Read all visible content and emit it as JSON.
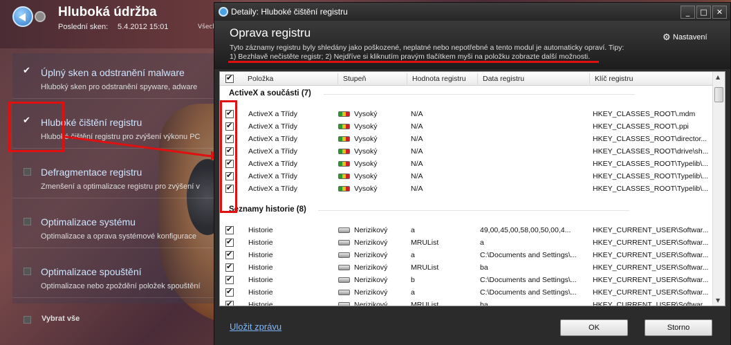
{
  "app": {
    "title": "Hluboká údržba",
    "last_scan_label": "Poslední sken:",
    "last_scan_value": "5.4.2012 15:01",
    "all_link": "Všechny",
    "items": [
      {
        "title": "Úplný sken a odstranění malware",
        "desc": "Hluboký sken pro odstranění spyware, adware",
        "checked": true
      },
      {
        "title": "Hluboké čištění registru",
        "desc": "Hluboké čištění registru pro zvýšení výkonu PC",
        "checked": true
      },
      {
        "title": "Defragmentace registru",
        "desc": "Zmenšení a optimalizace registru pro zvýšení v",
        "checked": false
      },
      {
        "title": "Optimalizace systému",
        "desc": "Optimalizace a oprava systémové konfigurace",
        "checked": false
      },
      {
        "title": "Optimalizace spouštění",
        "desc": "Optimalizace nebo zpoždění položek spouštění",
        "checked": false
      }
    ],
    "select_all": "Vybrat vše"
  },
  "dialog": {
    "title": "Detaily: Hluboké čištění registru",
    "controls": {
      "minimize": "_",
      "maximize": "□",
      "close": "✕"
    },
    "header_title": "Oprava registru",
    "header_desc_line1": "Tyto záznamy registru byly shledány jako poškozené, neplatné nebo nepotřebné a tento modul je automaticky opraví. Tipy:",
    "header_desc_line2": "1)  Bezhlavě nečistěte registr; 2) Nejdříve si kliknutím pravým tlačítkem myši na položku zobrazte další možnosti.",
    "settings_icon": "gear-icon",
    "settings_label": "Nastavení",
    "columns": [
      "Položka",
      "Stupeň",
      "Hodnota registru",
      "Data registru",
      "Klíč registru"
    ],
    "groups": [
      {
        "name": "ActiveX a součásti (7)",
        "rows": [
          {
            "item": "ActiveX a Třídy",
            "severity": "Vysoký",
            "value": "N/A",
            "data": "",
            "key": "HKEY_CLASSES_ROOT\\.mdm"
          },
          {
            "item": "ActiveX a Třídy",
            "severity": "Vysoký",
            "value": "N/A",
            "data": "",
            "key": "HKEY_CLASSES_ROOT\\.ppi"
          },
          {
            "item": "ActiveX a Třídy",
            "severity": "Vysoký",
            "value": "N/A",
            "data": "",
            "key": "HKEY_CLASSES_ROOT\\director..."
          },
          {
            "item": "ActiveX a Třídy",
            "severity": "Vysoký",
            "value": "N/A",
            "data": "",
            "key": "HKEY_CLASSES_ROOT\\drive\\sh..."
          },
          {
            "item": "ActiveX a Třídy",
            "severity": "Vysoký",
            "value": "N/A",
            "data": "",
            "key": "HKEY_CLASSES_ROOT\\Typelib\\..."
          },
          {
            "item": "ActiveX a Třídy",
            "severity": "Vysoký",
            "value": "N/A",
            "data": "",
            "key": "HKEY_CLASSES_ROOT\\Typelib\\..."
          },
          {
            "item": "ActiveX a Třídy",
            "severity": "Vysoký",
            "value": "N/A",
            "data": "",
            "key": "HKEY_CLASSES_ROOT\\Typelib\\..."
          }
        ]
      },
      {
        "name": "Seznamy historie (8)",
        "rows": [
          {
            "item": "Historie",
            "severity": "Nerizikový",
            "value": "a",
            "data": "49,00,45,00,58,00,50,00,4...",
            "key": "HKEY_CURRENT_USER\\Softwar..."
          },
          {
            "item": "Historie",
            "severity": "Nerizikový",
            "value": "MRUList",
            "data": "a",
            "key": "HKEY_CURRENT_USER\\Softwar..."
          },
          {
            "item": "Historie",
            "severity": "Nerizikový",
            "value": "a",
            "data": "C:\\Documents and Settings\\...",
            "key": "HKEY_CURRENT_USER\\Softwar..."
          },
          {
            "item": "Historie",
            "severity": "Nerizikový",
            "value": "MRUList",
            "data": "ba",
            "key": "HKEY_CURRENT_USER\\Softwar..."
          },
          {
            "item": "Historie",
            "severity": "Nerizikový",
            "value": "b",
            "data": "C:\\Documents and Settings\\...",
            "key": "HKEY_CURRENT_USER\\Softwar..."
          },
          {
            "item": "Historie",
            "severity": "Nerizikový",
            "value": "a",
            "data": "C:\\Documents and Settings\\...",
            "key": "HKEY_CURRENT_USER\\Softwar..."
          },
          {
            "item": "Historie",
            "severity": "Nerizikový",
            "value": "MRUList",
            "data": "ba",
            "key": "HKEY_CURRENT_USER\\Softwar..."
          }
        ]
      }
    ],
    "save_report": "Uložit zprávu",
    "ok": "OK",
    "cancel": "Storno"
  },
  "colors": {
    "annotation_red": "#e01010",
    "link_blue": "#7db8ff",
    "severity_high": "multicolor",
    "severity_low": "gray"
  }
}
